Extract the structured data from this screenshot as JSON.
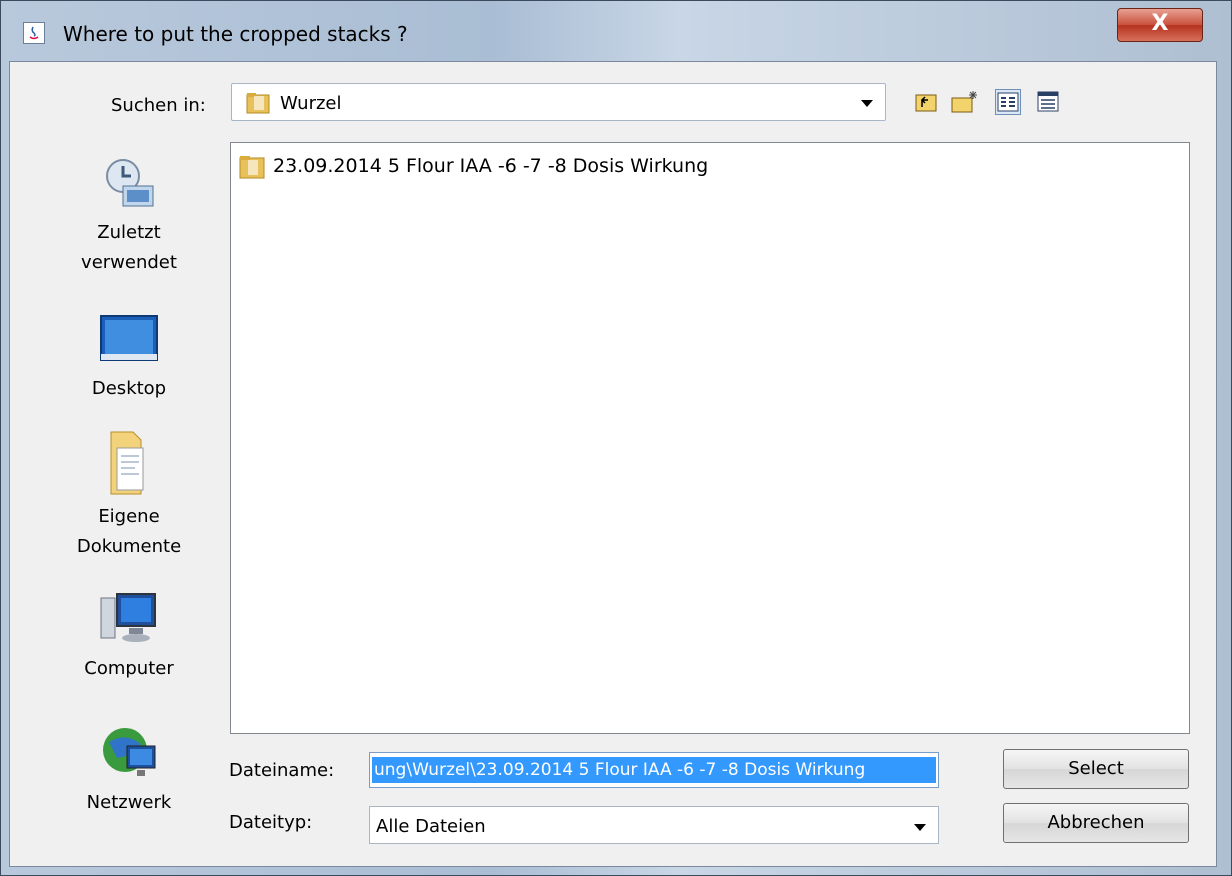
{
  "window": {
    "title": "Where to put the cropped stacks ?",
    "close_label": "X"
  },
  "toolbar": {
    "look_in_label": "Suchen in:",
    "look_in_value": "Wurzel",
    "buttons": [
      "up-folder-icon",
      "new-folder-icon",
      "list-view-icon",
      "details-view-icon"
    ]
  },
  "places": [
    {
      "label_line1": "Zuletzt",
      "label_line2": "verwendet",
      "icon": "recent-icon"
    },
    {
      "label_line1": "Desktop",
      "label_line2": "",
      "icon": "desktop-icon"
    },
    {
      "label_line1": "Eigene",
      "label_line2": "Dokumente",
      "icon": "documents-icon"
    },
    {
      "label_line1": "Computer",
      "label_line2": "",
      "icon": "computer-icon"
    },
    {
      "label_line1": "Netzwerk",
      "label_line2": "",
      "icon": "network-icon"
    }
  ],
  "files": [
    {
      "name": "23.09.2014 5 Flour IAA -6 -7 -8 Dosis Wirkung"
    }
  ],
  "form": {
    "filename_label": "Dateiname:",
    "filename_value": "ung\\Wurzel\\23.09.2014 5 Flour IAA -6 -7 -8 Dosis Wirkung",
    "filetype_label": "Dateityp:",
    "filetype_value": "Alle Dateien"
  },
  "buttons": {
    "select": "Select",
    "cancel": "Abbrechen"
  },
  "colors": {
    "selection": "#3399ff",
    "close_button": "#c9513d",
    "folder": "#e8c15a"
  }
}
